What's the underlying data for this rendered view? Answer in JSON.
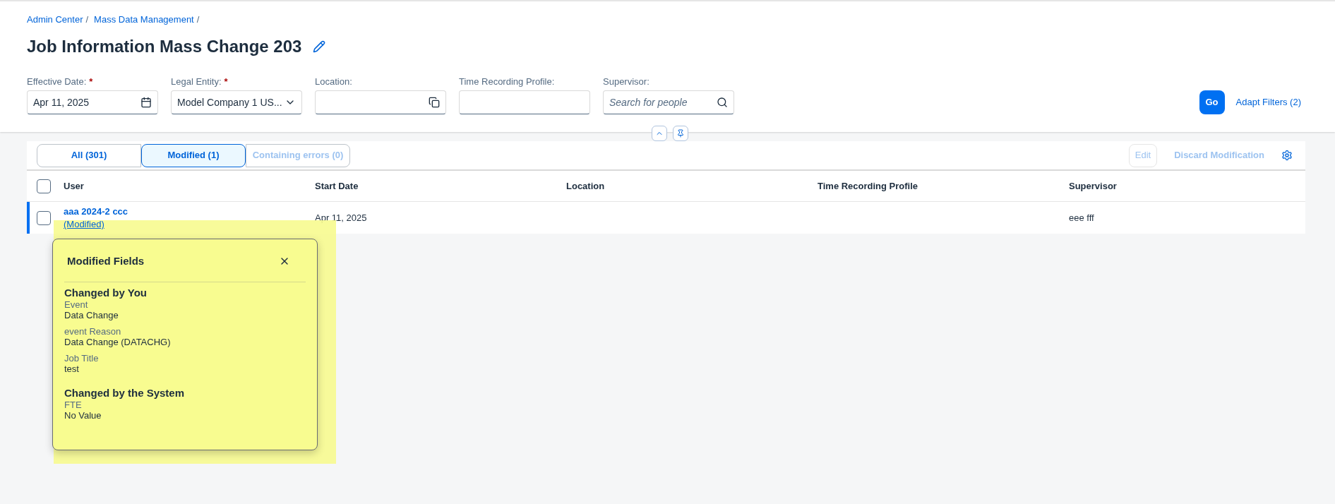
{
  "breadcrumb": [
    "Admin Center",
    "Mass Data Management"
  ],
  "breadcrumb_separator": "/",
  "required_mark": "*",
  "title": "Job Information Mass Change 203",
  "filters": [
    {
      "label": "Effective Date:",
      "required": true,
      "kind": "date",
      "value": "Apr 11, 2025"
    },
    {
      "label": "Legal Entity:",
      "required": true,
      "kind": "select",
      "value": "Model Company 1 US..."
    },
    {
      "label": "Location:",
      "required": false,
      "kind": "valuehelp"
    },
    {
      "label": "Time Recording Profile:",
      "required": false,
      "kind": "text"
    },
    {
      "label": "Supervisor:",
      "required": false,
      "kind": "search",
      "placeholder": "Search for people"
    }
  ],
  "go_button": "Go",
  "adapt_filters": "Adapt Filters (2)",
  "tabs": [
    {
      "label": "All (301)",
      "selected": false,
      "disabled": false
    },
    {
      "label": "Modified (1)",
      "selected": true,
      "disabled": false
    },
    {
      "label": "Containing errors (0)",
      "selected": false,
      "disabled": true
    }
  ],
  "toolbar": {
    "edit": {
      "label": "Edit",
      "disabled": true
    },
    "discard": {
      "label": "Discard Modification",
      "disabled": true
    }
  },
  "table": {
    "columns": [
      "User",
      "Start Date",
      "Location",
      "Time Recording Profile",
      "Supervisor"
    ],
    "select_all_checked": false,
    "rows": [
      {
        "user": "aaa 2024-2 ccc",
        "status": "(Modified)",
        "start_date": "Apr 11, 2025",
        "supervisor": "eee fff",
        "modified": true,
        "selected": false
      }
    ]
  },
  "popover": {
    "title": "Modified Fields",
    "sections": [
      {
        "heading": "Changed by You",
        "fields": [
          {
            "label": "Event",
            "value": "Data Change"
          },
          {
            "label": "event Reason",
            "value": "Data Change (DATACHG)"
          },
          {
            "label": "Job Title",
            "value": "test"
          }
        ]
      },
      {
        "heading": "Changed by the System",
        "fields": [
          {
            "label": "FTE",
            "value": "No Value"
          }
        ]
      }
    ]
  }
}
